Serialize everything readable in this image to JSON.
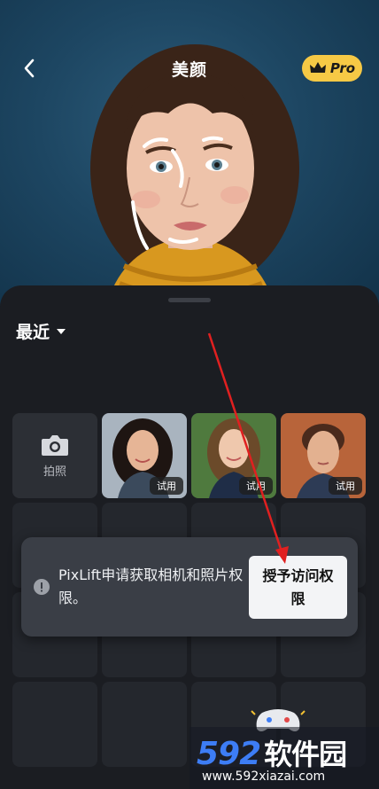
{
  "header": {
    "title": "美颜",
    "pro_label": "Pro"
  },
  "album": {
    "label": "最近"
  },
  "grid": {
    "camera_label": "拍照",
    "try_label": "试用",
    "photos": [
      {
        "try_label": "试用"
      },
      {
        "try_label": "试用"
      },
      {
        "try_label": "试用"
      }
    ]
  },
  "permission_toast": {
    "message": "PixLift申请获取相机和照片权限。",
    "button_label": "授予访问权限"
  },
  "watermark": {
    "logo_num": "592",
    "logo_cn": "软件园",
    "url": "www.592xiazai.com"
  },
  "colors": {
    "accent_pro": "#f6c945",
    "arrow": "#e02020",
    "watermark_blue": "#3d7df5"
  }
}
